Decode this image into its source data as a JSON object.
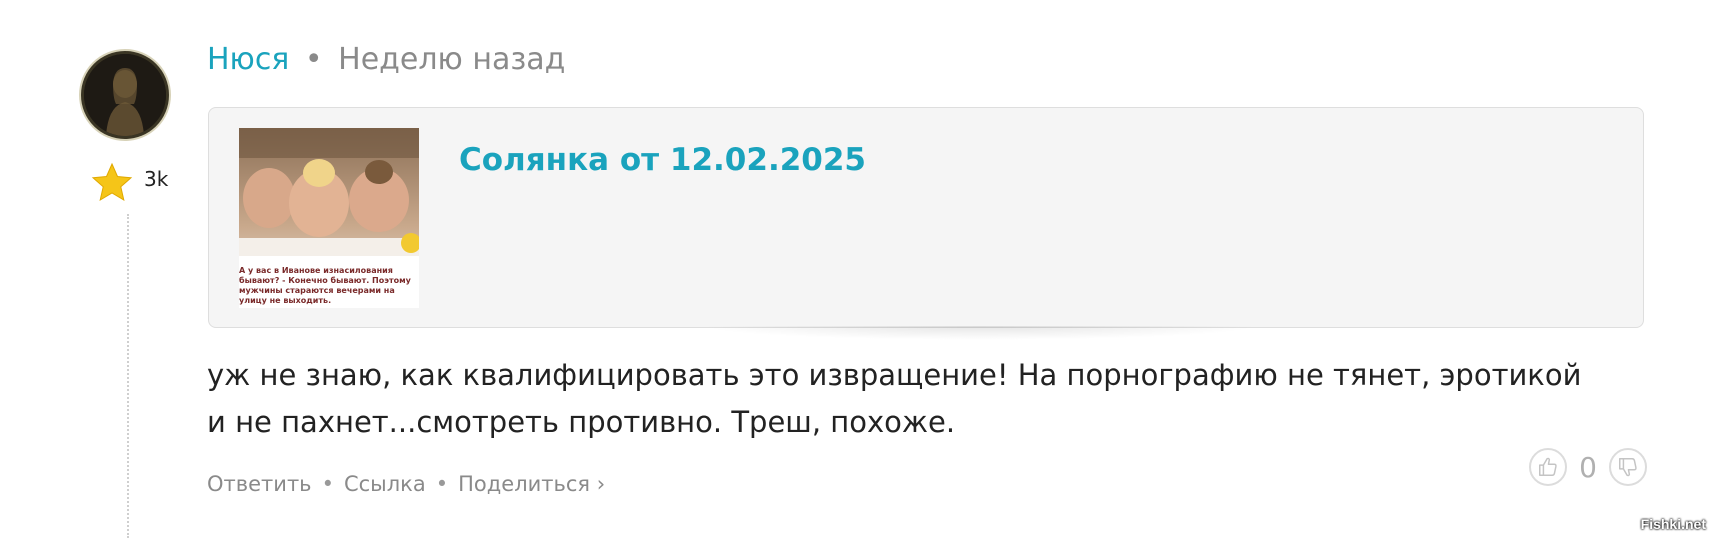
{
  "comment": {
    "author": "Нюся",
    "separator": "•",
    "time": "Неделю назад",
    "rating": "3k",
    "text": "уж не знаю, как квалифицировать это извращение! На порнографию не тянет, эротикой и не пахнет...смотреть противно. Треш, похоже."
  },
  "quote": {
    "title": "Солянка от 12.02.2025",
    "thumb_caption": "А у вас в Иванове изнасилования\nбывают? - Конечно бывают. Поэтому\nмужчины стараются вечерами на\nулицу не выходить."
  },
  "actions": {
    "reply": "Ответить",
    "link": "Ссылка",
    "share": "Поделиться ›",
    "bullet": "•"
  },
  "votes": {
    "count": "0"
  },
  "watermark": "Fishki.net",
  "icons": {
    "star": "star-icon",
    "like": "thumbs-up-icon",
    "dislike": "thumbs-down-icon"
  },
  "colors": {
    "accent": "#1aa3bd",
    "muted": "#8a8a8a",
    "text": "#222222",
    "card_bg": "#f5f5f5",
    "star": "#f5c518"
  }
}
